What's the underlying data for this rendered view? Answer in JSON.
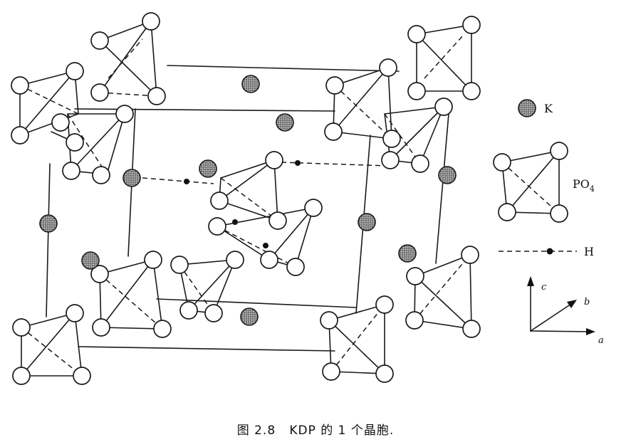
{
  "caption": "图 2.8   KDP 的 1 个晶胞.",
  "legend": {
    "k_label": "K",
    "po4_label": "PO",
    "po4_subscript": "4",
    "h_label": "H"
  },
  "axes": {
    "c_label": "c",
    "b_label": "b",
    "a_label": "a"
  },
  "colors": {
    "line": "#1a1a1a",
    "k_fill": "#8a8a8a",
    "oxygen_fill": "#ffffff"
  }
}
